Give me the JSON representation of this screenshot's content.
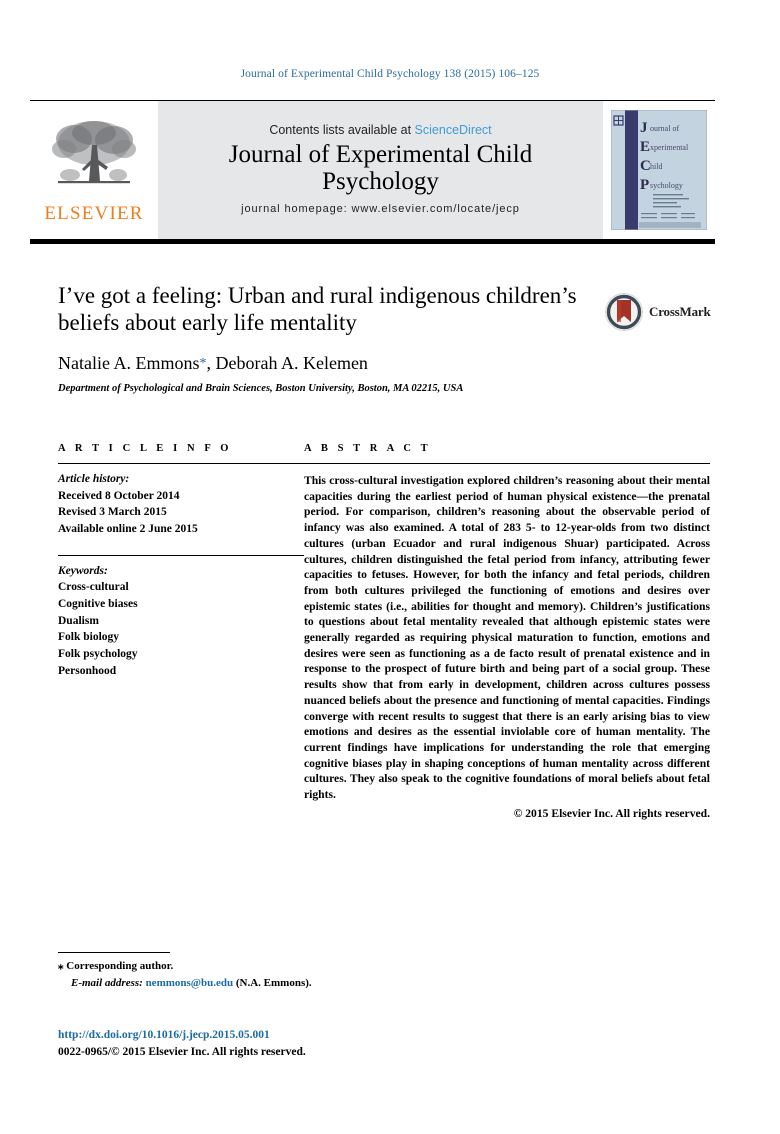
{
  "running_head": "Journal of Experimental Child Psychology 138 (2015) 106–125",
  "masthead": {
    "publisher_name": "ELSEVIER",
    "contents_prefix": "Contents lists available at ",
    "contents_link": "ScienceDirect",
    "journal_title_line1": "Journal of Experimental Child",
    "journal_title_line2": "Psychology",
    "homepage": "journal homepage: www.elsevier.com/locate/jecp",
    "cover": {
      "letters": [
        "J",
        "E",
        "C",
        "P"
      ],
      "words": [
        "ournal of",
        "xperimental",
        "hild",
        "sychology"
      ],
      "band_color": "#3b3a6e",
      "bg_color": "#c3d3e0"
    }
  },
  "article": {
    "title": "I’ve got a feeling: Urban and rural indigenous children’s beliefs about early life mentality",
    "authors": "Natalie A. Emmons",
    "corresponding_marker": "*",
    "authors_rest": ", Deborah A. Kelemen",
    "affiliation": "Department of Psychological and Brain Sciences, Boston University, Boston, MA 02215, USA",
    "crossmark_label": "CrossMark"
  },
  "article_info": {
    "heading": "A R T I C L E   I N F O",
    "history_label": "Article history:",
    "history": [
      "Received 8 October 2014",
      "Revised 3 March 2015",
      "Available online 2 June 2015"
    ],
    "keywords_label": "Keywords:",
    "keywords": [
      "Cross-cultural",
      "Cognitive biases",
      "Dualism",
      "Folk biology",
      "Folk psychology",
      "Personhood"
    ]
  },
  "abstract": {
    "heading": "A B S T R A C T",
    "text": "This cross-cultural investigation explored children’s reasoning about their mental capacities during the earliest period of human physical existence—the prenatal period. For comparison, children’s reasoning about the observable period of infancy was also examined. A total of 283 5- to 12-year-olds from two distinct cultures (urban Ecuador and rural indigenous Shuar) participated. Across cultures, children distinguished the fetal period from infancy, attributing fewer capacities to fetuses. However, for both the infancy and fetal periods, children from both cultures privileged the functioning of emotions and desires over epistemic states (i.e., abilities for thought and memory). Children’s justifications to questions about fetal mentality revealed that although epistemic states were generally regarded as requiring physical maturation to function, emotions and desires were seen as functioning as a de facto result of prenatal existence and in response to the prospect of future birth and being part of a social group. These results show that from early in development, children across cultures possess nuanced beliefs about the presence and functioning of mental capacities. Findings converge with recent results to suggest that there is an early arising bias to view emotions and desires as the essential inviolable core of human mentality. The current findings have implications for understanding the role that emerging cognitive biases play in shaping conceptions of human mentality across different cultures. They also speak to the cognitive foundations of moral beliefs about fetal rights.",
    "copyright": "© 2015 Elsevier Inc. All rights reserved."
  },
  "footnotes": {
    "corresponding_marker": "⁎",
    "corresponding_text": "Corresponding author.",
    "email_label": "E-mail address:",
    "email": "nemmons@bu.edu",
    "email_attrib": "(N.A. Emmons)."
  },
  "footer": {
    "doi": "http://dx.doi.org/10.1016/j.jecp.2015.05.001",
    "issn_copyright": "0022-0965/© 2015 Elsevier Inc. All rights reserved."
  },
  "colors": {
    "link_blue": "#1b6ba4",
    "sciencedirect_blue": "#3f9cd6",
    "elsevier_orange": "#f07d1b",
    "banner_gray": "#e6e7e8"
  }
}
